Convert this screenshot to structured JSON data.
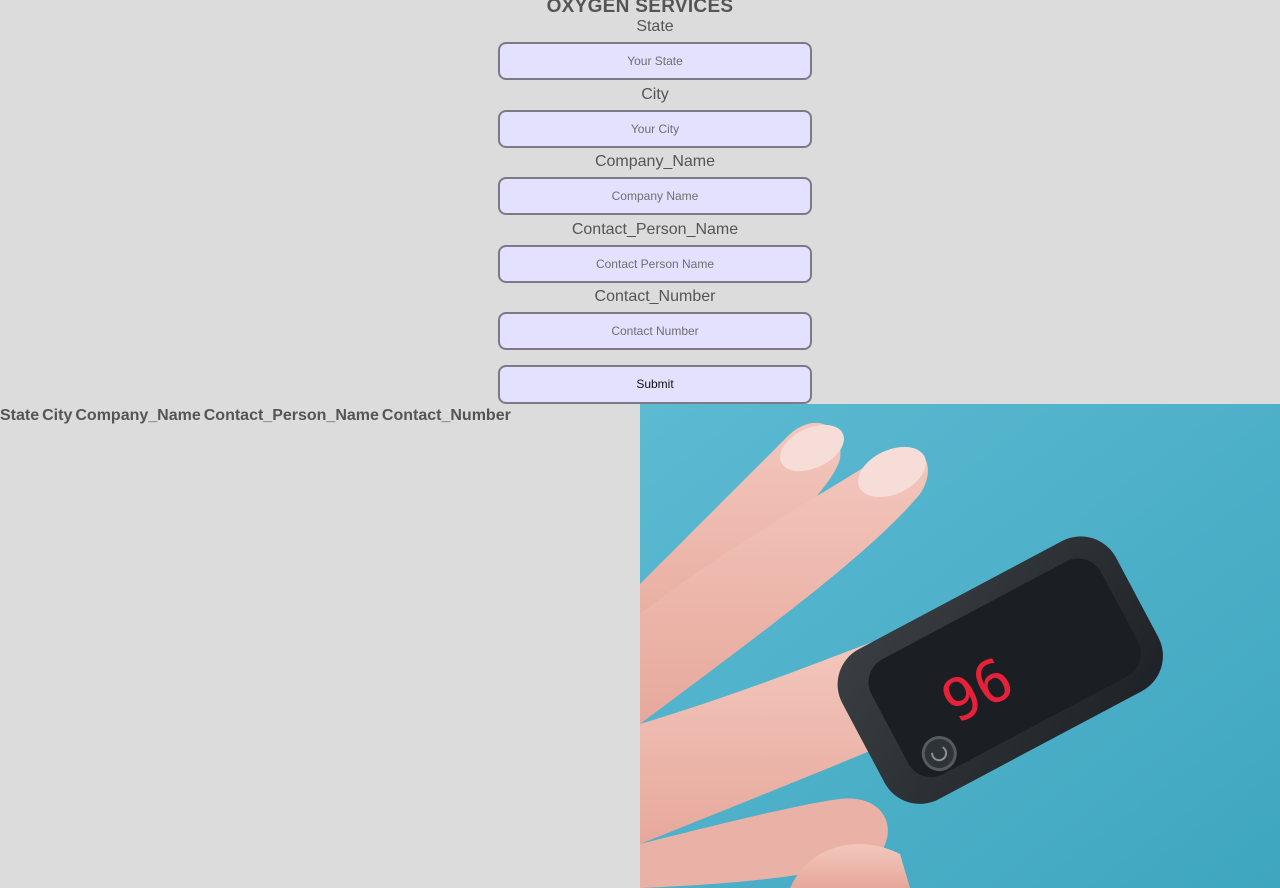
{
  "header": {
    "title": "OXYGEN SERVICES"
  },
  "form": {
    "fields": [
      {
        "label": "State",
        "placeholder": "Your State",
        "value": ""
      },
      {
        "label": "City",
        "placeholder": "Your City",
        "value": ""
      },
      {
        "label": "Company_Name",
        "placeholder": "Company Name",
        "value": ""
      },
      {
        "label": "Contact_Person_Name",
        "placeholder": "Contact Person Name",
        "value": ""
      },
      {
        "label": "Contact_Number",
        "placeholder": "Contact Number",
        "value": ""
      }
    ],
    "submit_label": "Submit"
  },
  "table": {
    "columns": [
      "State",
      "City",
      "Company_Name",
      "Contact_Person_Name",
      "Contact_Number"
    ]
  },
  "image": {
    "subject": "pulse-oximeter-on-finger",
    "display_digits": "96",
    "colors": {
      "background": "#4cb0c9",
      "device": "#2c3034",
      "digits": "#e8213a"
    }
  },
  "colors": {
    "page_bg": "#dcdcdc",
    "input_bg": "#e4e0ff",
    "input_border": "#7d7a86",
    "text": "#555555"
  }
}
